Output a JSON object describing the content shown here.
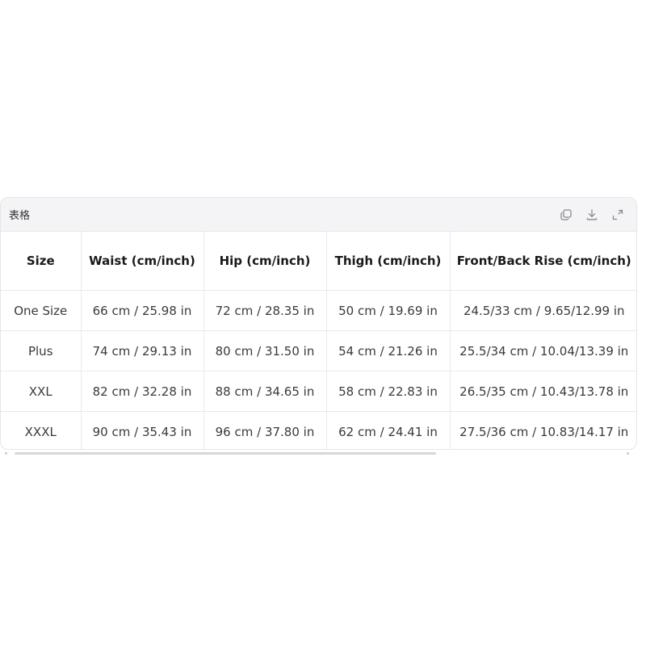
{
  "panel": {
    "title": "表格",
    "actions": [
      {
        "name": "copy",
        "icon": "copy-icon"
      },
      {
        "name": "download",
        "icon": "download-icon"
      },
      {
        "name": "expand",
        "icon": "expand-icon"
      }
    ]
  },
  "table": {
    "headers": [
      "Size",
      "Waist (cm/inch)",
      "Hip (cm/inch)",
      "Thigh (cm/inch)",
      "Front/Back Rise (cm/inch)"
    ],
    "rows": [
      [
        "One Size",
        "66 cm / 25.98 in",
        "72 cm / 28.35 in",
        "50 cm / 19.69 in",
        "24.5/33 cm / 9.65/12.99 in"
      ],
      [
        "Plus",
        "74 cm / 29.13 in",
        "80 cm / 31.50 in",
        "54 cm / 21.26 in",
        "25.5/34 cm / 10.04/13.39 in"
      ],
      [
        "XXL",
        "82 cm / 32.28 in",
        "88 cm / 34.65 in",
        "58 cm / 22.83 in",
        "26.5/35 cm / 10.43/13.78 in"
      ],
      [
        "XXXL",
        "90 cm / 35.43 in",
        "96 cm / 37.80 in",
        "62 cm / 24.41 in",
        "27.5/36 cm / 10.83/14.17 in"
      ]
    ]
  },
  "colors": {
    "header_bg": "#f4f4f6",
    "border": "#e9e9ec",
    "icon": "#8a8a8f"
  }
}
